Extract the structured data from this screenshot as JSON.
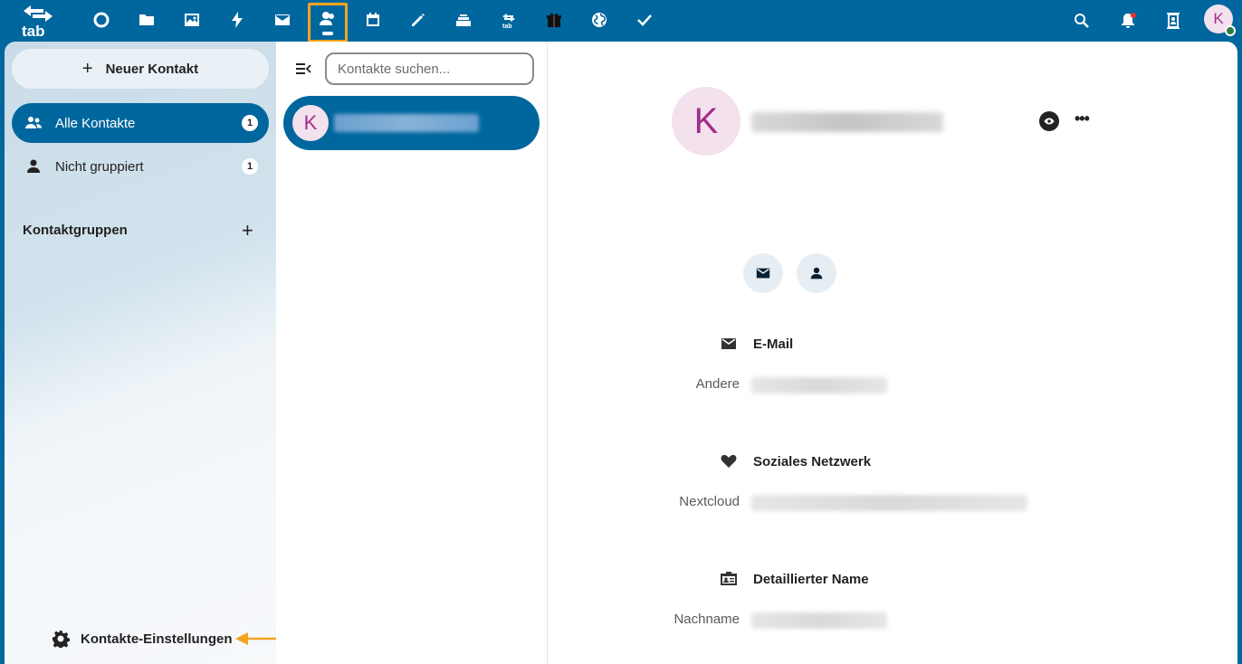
{
  "topbar": {
    "logo_text": "tab",
    "apps": [
      {
        "name": "dashboard"
      },
      {
        "name": "files"
      },
      {
        "name": "photos"
      },
      {
        "name": "activity"
      },
      {
        "name": "mail"
      },
      {
        "name": "contacts",
        "active": true
      },
      {
        "name": "calendar"
      },
      {
        "name": "notes"
      },
      {
        "name": "deck"
      },
      {
        "name": "tab-transfer"
      },
      {
        "name": "gift"
      },
      {
        "name": "globe"
      },
      {
        "name": "tasks"
      }
    ],
    "user_initial": "K",
    "accent_color": "#00679e",
    "highlight_color": "#f5a31e"
  },
  "sidebar": {
    "new_contact": "Neuer Kontakt",
    "items": [
      {
        "label": "Alle Kontakte",
        "count": "1"
      },
      {
        "label": "Nicht gruppiert",
        "count": "1"
      }
    ],
    "groups_title": "Kontaktgruppen",
    "settings": "Kontakte-Einstellungen"
  },
  "list": {
    "search_placeholder": "Kontakte suchen...",
    "contact_initial": "K"
  },
  "details": {
    "avatar_initial": "K",
    "sections": [
      {
        "title": "E-Mail",
        "field_label": "Andere"
      },
      {
        "title": "Soziales Netzwerk",
        "field_label": "Nextcloud"
      },
      {
        "title": "Detaillierter Name",
        "field_label": "Nachname"
      }
    ]
  }
}
